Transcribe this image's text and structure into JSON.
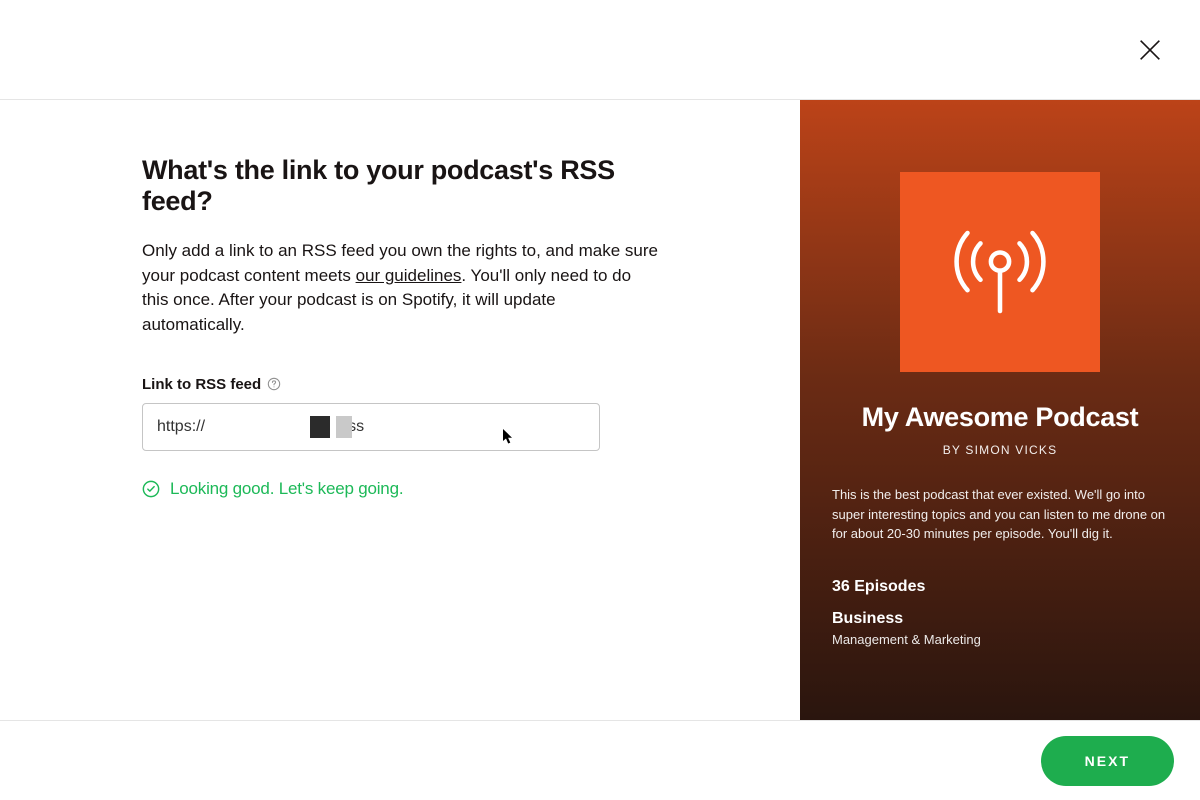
{
  "form": {
    "heading": "What's the link to your podcast's RSS feed?",
    "description_part1": "Only add a link to an RSS feed you own the rights to, and make sure your podcast content meets ",
    "guidelines_link_text": "our guidelines",
    "description_part2": ". You'll only need to do this once. After your podcast is on Spotify, it will update automatically.",
    "field_label": "Link to RSS feed",
    "input_value": "https://                               rss",
    "validation_text": "Looking good. Let's keep going."
  },
  "preview": {
    "title": "My Awesome Podcast",
    "author_prefix": "BY ",
    "author": "SIMON VICKS",
    "description": "This is the best podcast that ever existed. We'll go into super interesting topics and you can listen to me drone on for about 20-30 minutes per episode. You'll dig it.",
    "episodes": "36 Episodes",
    "category": "Business",
    "subcategory": "Management & Marketing"
  },
  "actions": {
    "next_label": "NEXT"
  },
  "colors": {
    "accent_green": "#1ead4e",
    "validation_green": "#1db958",
    "artwork_orange": "#ee5722"
  }
}
